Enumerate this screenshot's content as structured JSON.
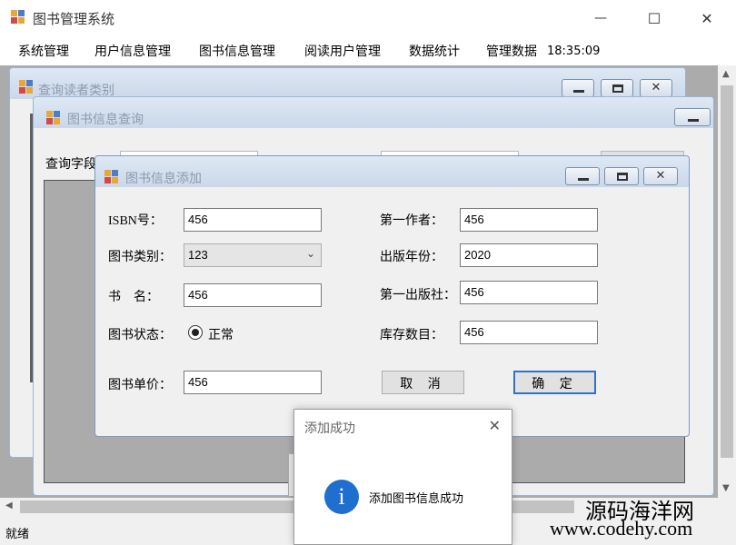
{
  "app": {
    "title": "图书管理系统"
  },
  "window_controls": {
    "minimize": "—",
    "maximize": "☐",
    "close": "✕"
  },
  "menu": [
    "系统管理",
    "用户信息管理",
    "图书信息管理",
    "阅读用户管理",
    "数据统计",
    "管理数据"
  ],
  "clock": "18:35:09",
  "statusbar": {
    "text": "就绪"
  },
  "windows": {
    "readers": {
      "title": "查询读者类别"
    },
    "query": {
      "title": "图书信息查询",
      "field_label": "查询字段"
    },
    "add": {
      "title": "图书信息添加",
      "labels": {
        "isbn": "ISBN号：",
        "category": "图书类别：",
        "name": "书　名：",
        "status": "图书状态：",
        "price": "图书单价：",
        "author": "第一作者：",
        "year": "出版年份：",
        "publisher": "第一出版社：",
        "stock": "库存数目："
      },
      "values": {
        "isbn": "456",
        "category": "123",
        "name": "456",
        "price": "456",
        "author": "456",
        "year": "2020",
        "publisher": "456",
        "stock": "456"
      },
      "status_option": "正常",
      "cancel_button": "取 消",
      "ok_button": "确 定"
    }
  },
  "messagebox": {
    "title": "添加成功",
    "text": "添加图书信息成功",
    "icon": "information-icon"
  },
  "watermark": {
    "line1": "源码海洋网",
    "line2": "www.codehy.com"
  }
}
